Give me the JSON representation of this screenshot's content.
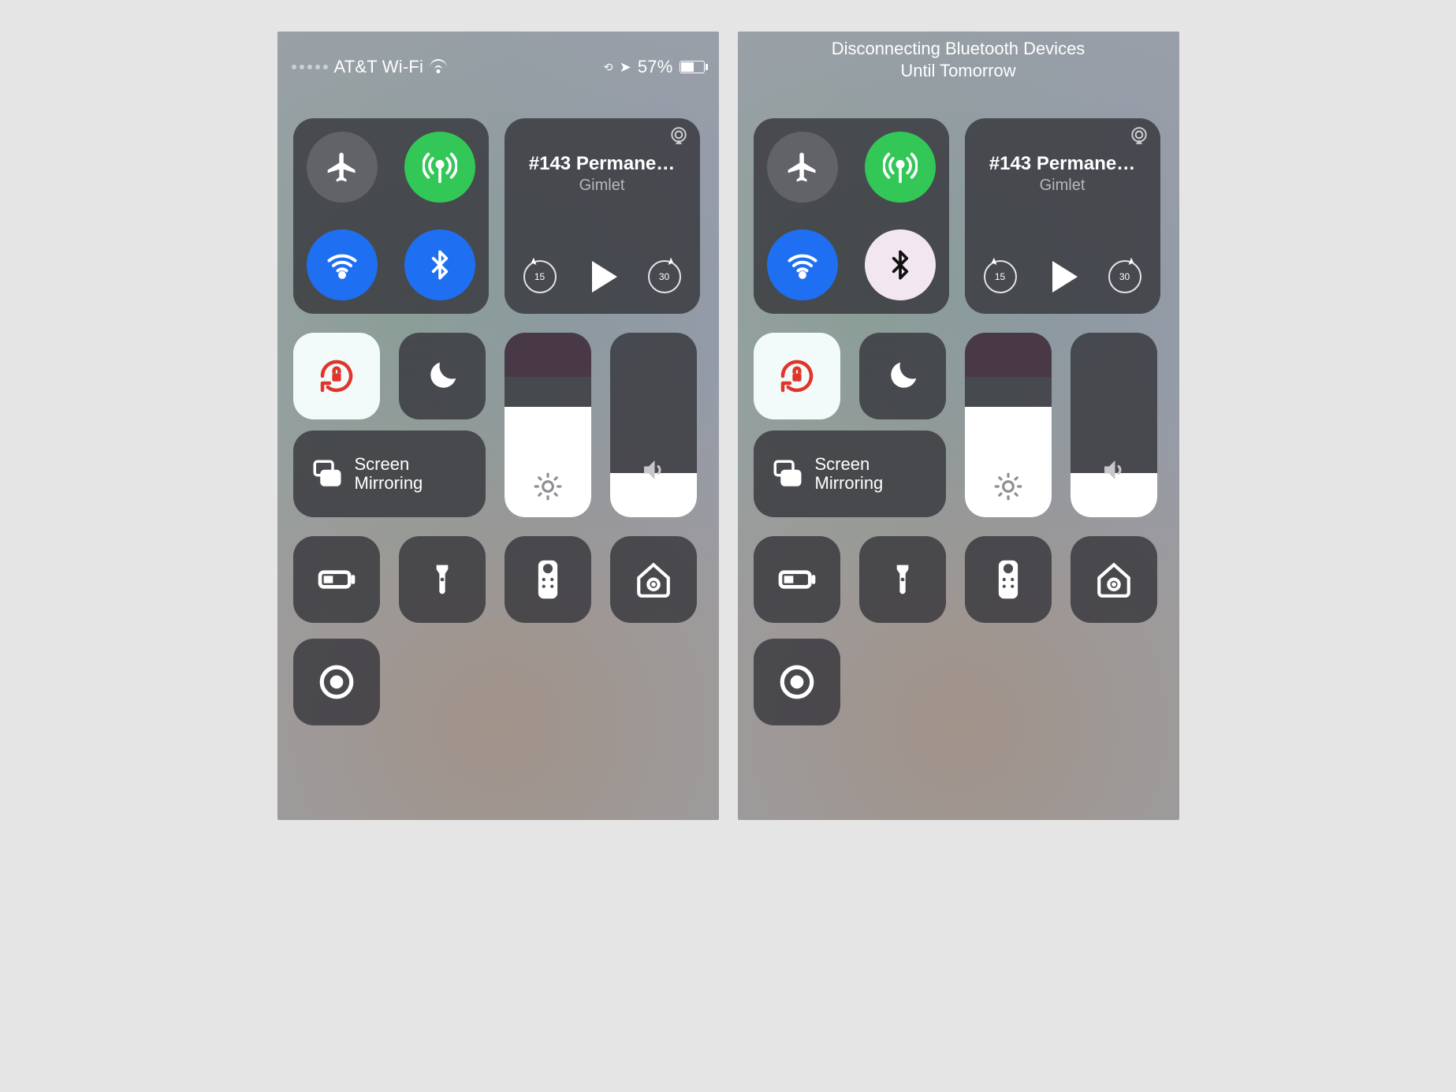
{
  "left": {
    "status": {
      "carrier": "AT&T Wi-Fi",
      "battery_pct": "57%"
    },
    "connectivity": {
      "airplane": false,
      "cellular": true,
      "wifi": true,
      "bluetooth": true
    },
    "media": {
      "title": "#143 Permane…",
      "subtitle": "Gimlet",
      "skip_back": "15",
      "skip_forward": "30"
    },
    "orientation_lock_on": true,
    "dnd_on": false,
    "screen_mirroring_label": "Screen\nMirroring",
    "brightness_pct": 60,
    "volume_pct": 24
  },
  "right": {
    "status_message_line1": "Disconnecting Bluetooth Devices",
    "status_message_line2": "Until Tomorrow",
    "connectivity": {
      "airplane": false,
      "cellular": true,
      "wifi": true,
      "bluetooth": false
    },
    "media": {
      "title": "#143 Permane…",
      "subtitle": "Gimlet",
      "skip_back": "15",
      "skip_forward": "30"
    },
    "orientation_lock_on": true,
    "dnd_on": false,
    "screen_mirroring_label": "Screen\nMirroring",
    "brightness_pct": 60,
    "volume_pct": 24
  },
  "icons": {
    "airplane": "airplane-icon",
    "cellular": "cellular-antenna-icon",
    "wifi": "wifi-icon",
    "bluetooth": "bluetooth-icon",
    "airplay": "airplay-icon",
    "orientation_lock": "orientation-lock-icon",
    "moon": "moon-icon",
    "screen_mirroring": "screen-mirroring-icon",
    "brightness": "sun-icon",
    "volume": "speaker-icon",
    "low_power": "battery-low-power-icon",
    "flashlight": "flashlight-icon",
    "remote": "apple-tv-remote-icon",
    "home": "home-icon",
    "record": "screen-record-icon"
  }
}
